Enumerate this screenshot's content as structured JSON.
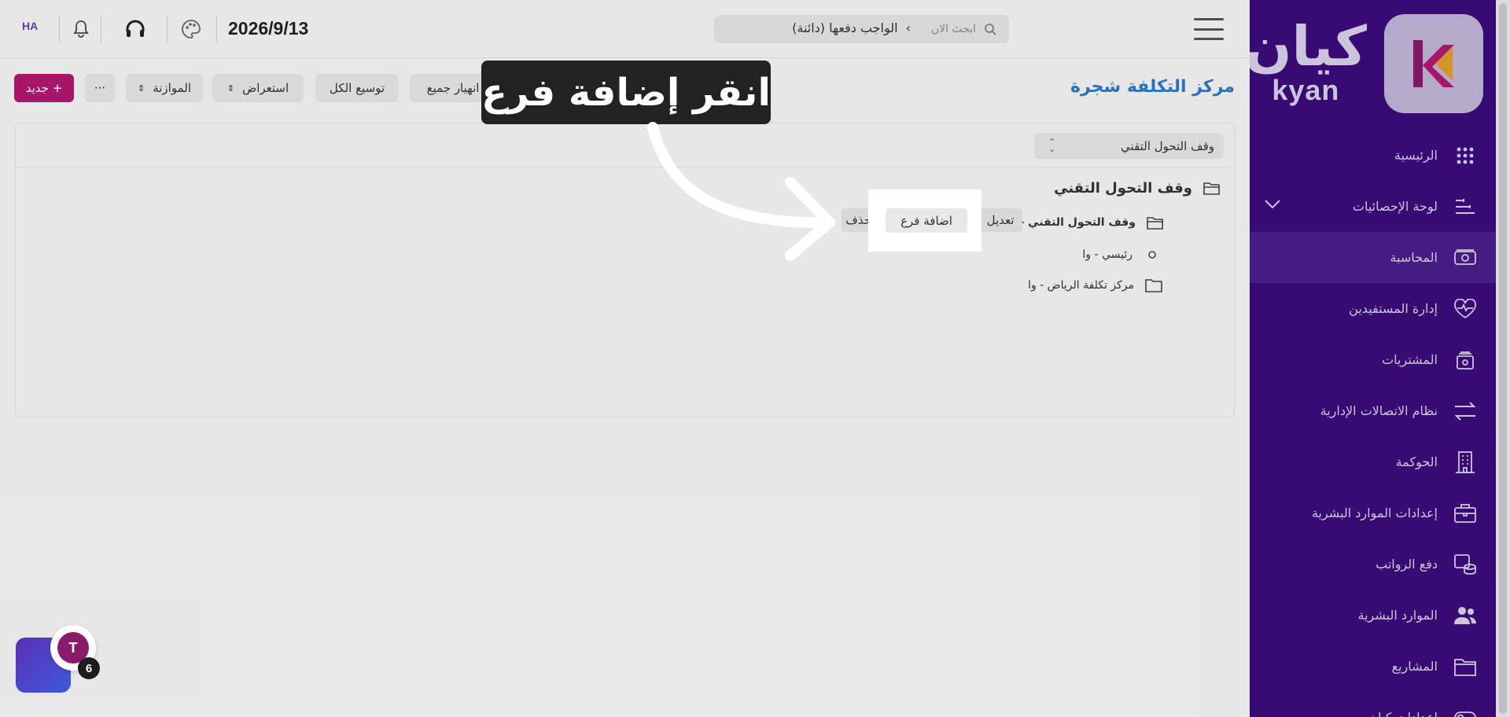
{
  "brand": {
    "name_ar": "كيان",
    "name_en": "kyan",
    "primary": "#3a0c7a",
    "accent": "#b0186f",
    "logo_colors": [
      "#b0186f",
      "#e39a1a"
    ]
  },
  "sidebar": {
    "items": [
      {
        "label": "الرئيسية",
        "icon": "grid-dots-icon"
      },
      {
        "label": "لوحة الإحصائيات",
        "icon": "sliders-icon",
        "expandable": true
      },
      {
        "label": "المحاسبة",
        "icon": "money-icon",
        "active": true
      },
      {
        "label": "إدارة المستفيدين",
        "icon": "heart-pulse-icon"
      },
      {
        "label": "المشتريات",
        "icon": "cart-icon"
      },
      {
        "label": "نظام الاتصالات الإدارية",
        "icon": "arrows-exchange-icon"
      },
      {
        "label": "الحوكمة",
        "icon": "building-icon"
      },
      {
        "label": "إعدادات الموارد البشرية",
        "icon": "briefcase-icon"
      },
      {
        "label": "دفع الرواتب",
        "icon": "coins-icon"
      },
      {
        "label": "الموارد البشرية",
        "icon": "users-icon"
      },
      {
        "label": "المشاريع",
        "icon": "folder-icon"
      },
      {
        "label": "إعدادات كيان",
        "icon": "toggle-icon"
      }
    ]
  },
  "topbar": {
    "breadcrumb": "الواجب دفعها (دائنة)",
    "breadcrumb_sep": "›",
    "search_placeholder": "ابحث الان",
    "date": "2026/9/13",
    "avatar_initials": "HA"
  },
  "page": {
    "title": "مركز التكلفة شجرة",
    "toolbar": {
      "new_label": "+ جديد",
      "more_label": "···",
      "balance_label": "الموازنة",
      "view_label": "استعراض",
      "expand_all_label": "توسيع الكل",
      "collapse_all_label": "انهيار جميع"
    }
  },
  "tree": {
    "company_select": "وقف التحول التقني",
    "root": "وقف التحول التقني",
    "children": [
      {
        "label": "وقف التحول التقني - واا",
        "type": "folder-open"
      },
      {
        "label": "رئيسي - وا",
        "type": "leaf"
      },
      {
        "label": "مركز تكلفة الرياض - وا",
        "type": "folder"
      }
    ],
    "row_actions": {
      "edit": "تعديل",
      "add_child": "اضافة فرع",
      "delete": "حذف"
    }
  },
  "callout": {
    "text": "انقر إضافة فرع"
  },
  "chat": {
    "badge_letter": "T",
    "count": "6"
  }
}
